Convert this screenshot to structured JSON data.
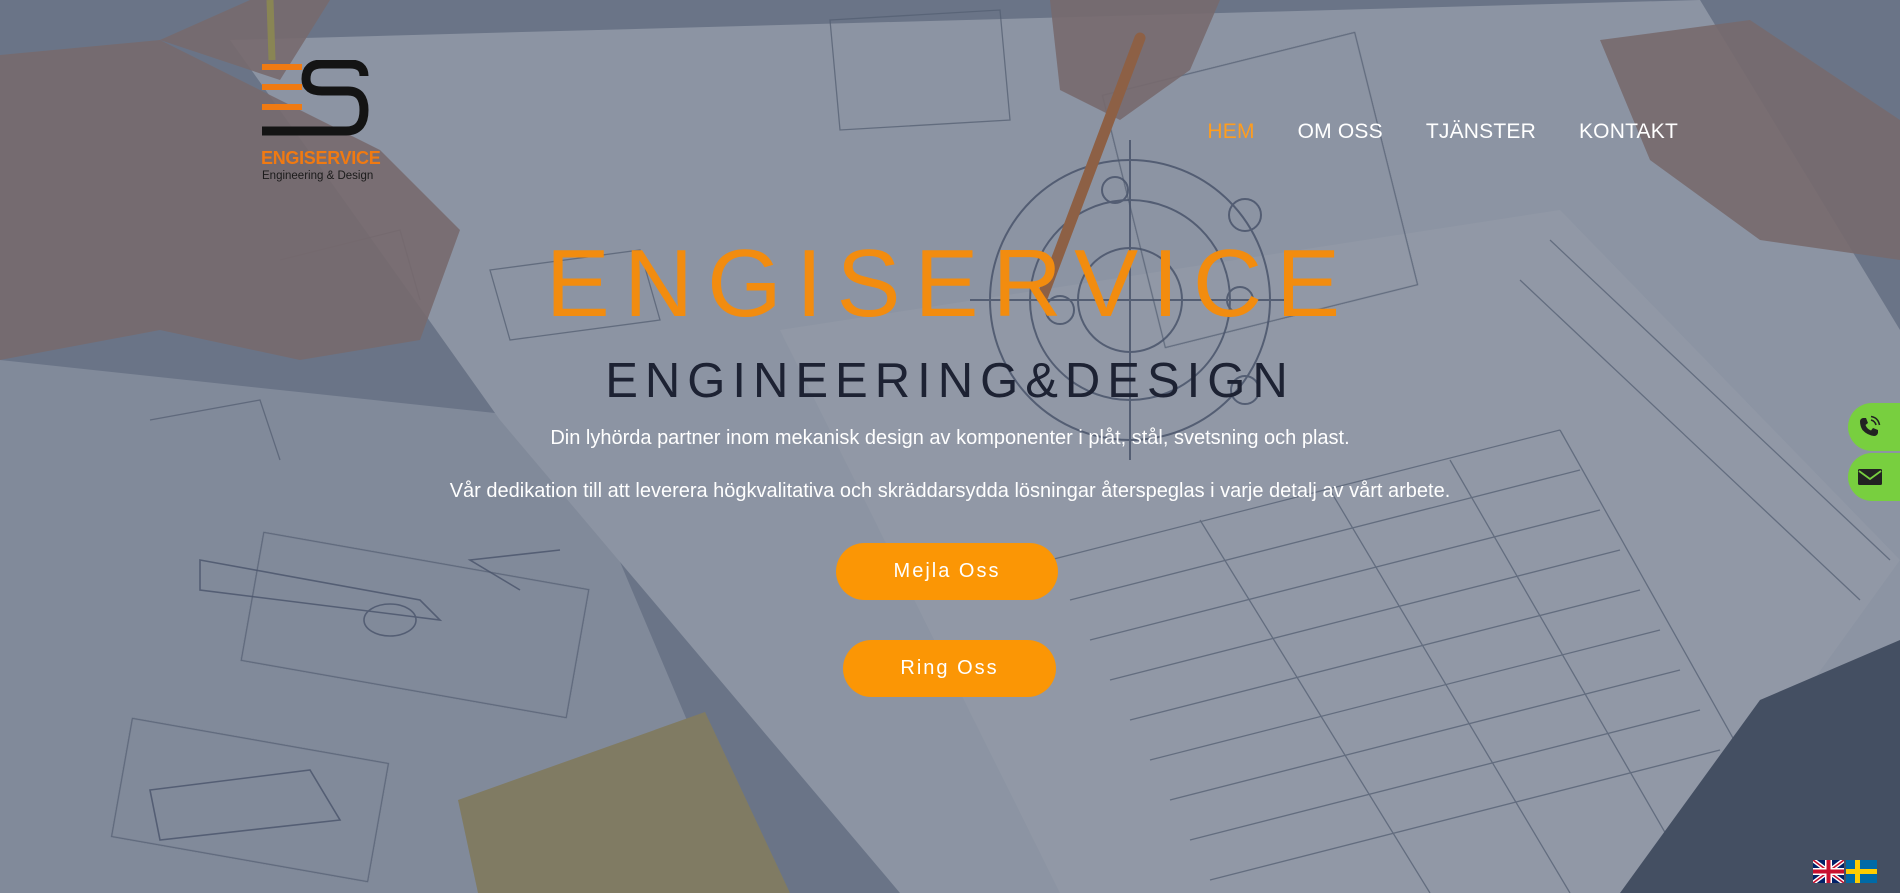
{
  "brand": {
    "name": "ENGISERVICE",
    "tagline": "Engineering & Design",
    "orange": "#f07a12",
    "dark": "#1b1b1b"
  },
  "nav": {
    "items": [
      {
        "label": "HEM",
        "active": true
      },
      {
        "label": "OM OSS",
        "active": false
      },
      {
        "label": "TJÄNSTER",
        "active": false
      },
      {
        "label": "KONTAKT",
        "active": false
      }
    ],
    "active_color": "#ff9d1e"
  },
  "hero": {
    "title": "ENGISERVICE",
    "subtitle": "ENGINEERING&DESIGN",
    "line1": "Din lyhörda partner inom mekanisk design av komponenter i plåt, stål, svetsning och plast.",
    "line2": "Vår dedikation till att leverera högkvalitativa och skräddarsydda lösningar återspeglas i varje detalj av vårt arbete.",
    "background": "technical-blueprint-drawing-with-hands-and-pencil"
  },
  "buttons": {
    "mail": "Mejla Oss",
    "call": "Ring Oss",
    "color": "#fb9605"
  },
  "floating_contact": {
    "phone_icon": "phone-icon",
    "mail_icon": "envelope-icon",
    "color": "#78cf3f"
  },
  "languages": [
    {
      "code": "en",
      "icon": "uk-flag-icon"
    },
    {
      "code": "sv",
      "icon": "sweden-flag-icon"
    }
  ]
}
